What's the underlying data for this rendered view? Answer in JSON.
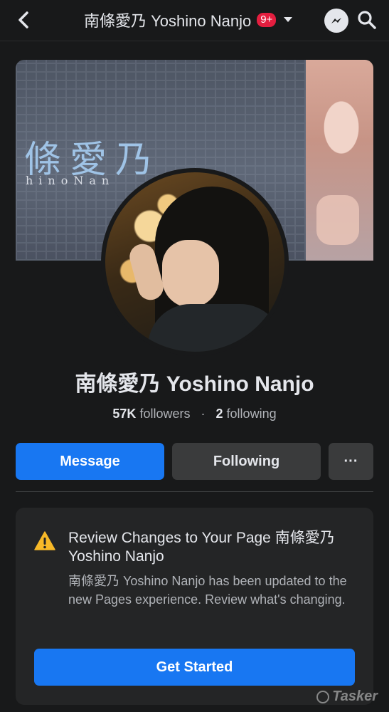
{
  "topbar": {
    "title": "南條愛乃 Yoshino Nanjo",
    "notification_count": "9+"
  },
  "cover": {
    "kanji_text": "條愛乃",
    "sub_text": "hinoNan"
  },
  "profile": {
    "name": "南條愛乃 Yoshino Nanjo",
    "followers_count": "57K",
    "followers_label": "followers",
    "separator": "·",
    "following_count": "2",
    "following_label": "following"
  },
  "actions": {
    "message_label": "Message",
    "following_label": "Following",
    "more_label": "···"
  },
  "review_card": {
    "title": "Review Changes to Your Page 南條愛乃 Yoshino Nanjo",
    "body": "南條愛乃 Yoshino Nanjo has been updated to the new Pages experience. Review what's changing.",
    "button_label": "Get Started"
  },
  "watermark": {
    "text": "Tasker"
  },
  "colors": {
    "background": "#18191a",
    "card": "#242526",
    "button_primary": "#1877f2",
    "button_secondary": "#3a3b3c",
    "badge": "#e41e3f",
    "warning": "#f7b928"
  }
}
